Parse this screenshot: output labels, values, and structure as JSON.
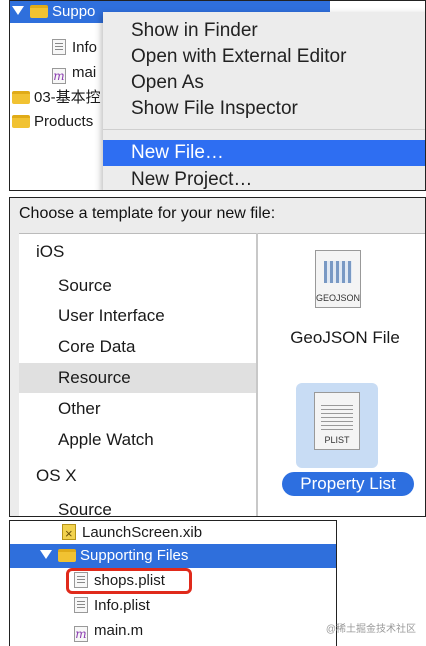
{
  "tree_top": {
    "rows": [
      {
        "label": "Suppo"
      },
      {
        "label": "Info"
      },
      {
        "label": "mai"
      },
      {
        "label": "03-基本控"
      },
      {
        "label": "Products"
      }
    ]
  },
  "context_menu": {
    "items": [
      {
        "label": "Show in Finder"
      },
      {
        "label": "Open with External Editor"
      },
      {
        "label": "Open As"
      },
      {
        "label": "Show File Inspector"
      },
      {
        "label": "New File…"
      },
      {
        "label": "New Project…"
      }
    ]
  },
  "template_chooser": {
    "title": "Choose a template for your new file:",
    "list": [
      {
        "label": "iOS",
        "kind": "header"
      },
      {
        "label": "Source",
        "kind": "sub"
      },
      {
        "label": "User Interface",
        "kind": "sub"
      },
      {
        "label": "Core Data",
        "kind": "sub"
      },
      {
        "label": "Resource",
        "kind": "sub",
        "selected": true
      },
      {
        "label": "Other",
        "kind": "sub"
      },
      {
        "label": "Apple Watch",
        "kind": "sub"
      },
      {
        "label": "OS X",
        "kind": "header"
      },
      {
        "label": "Source",
        "kind": "sub"
      }
    ],
    "templates": [
      {
        "name": "GeoJSON File",
        "icon_caption": "GEOJSON"
      },
      {
        "name": "Property List",
        "icon_caption": "PLIST",
        "selected": true
      }
    ]
  },
  "navigator": {
    "rows": [
      {
        "label": "LaunchScreen.xib"
      },
      {
        "label": "Supporting Files"
      },
      {
        "label": "shops.plist"
      },
      {
        "label": "Info.plist"
      },
      {
        "label": "main.m"
      }
    ]
  },
  "watermark": "@稀土掘金技术社区",
  "colors": {
    "selection_blue": "#2f6fdc",
    "highlight_outline": "#e02a1b",
    "folder_yellow": "#f1c232"
  }
}
